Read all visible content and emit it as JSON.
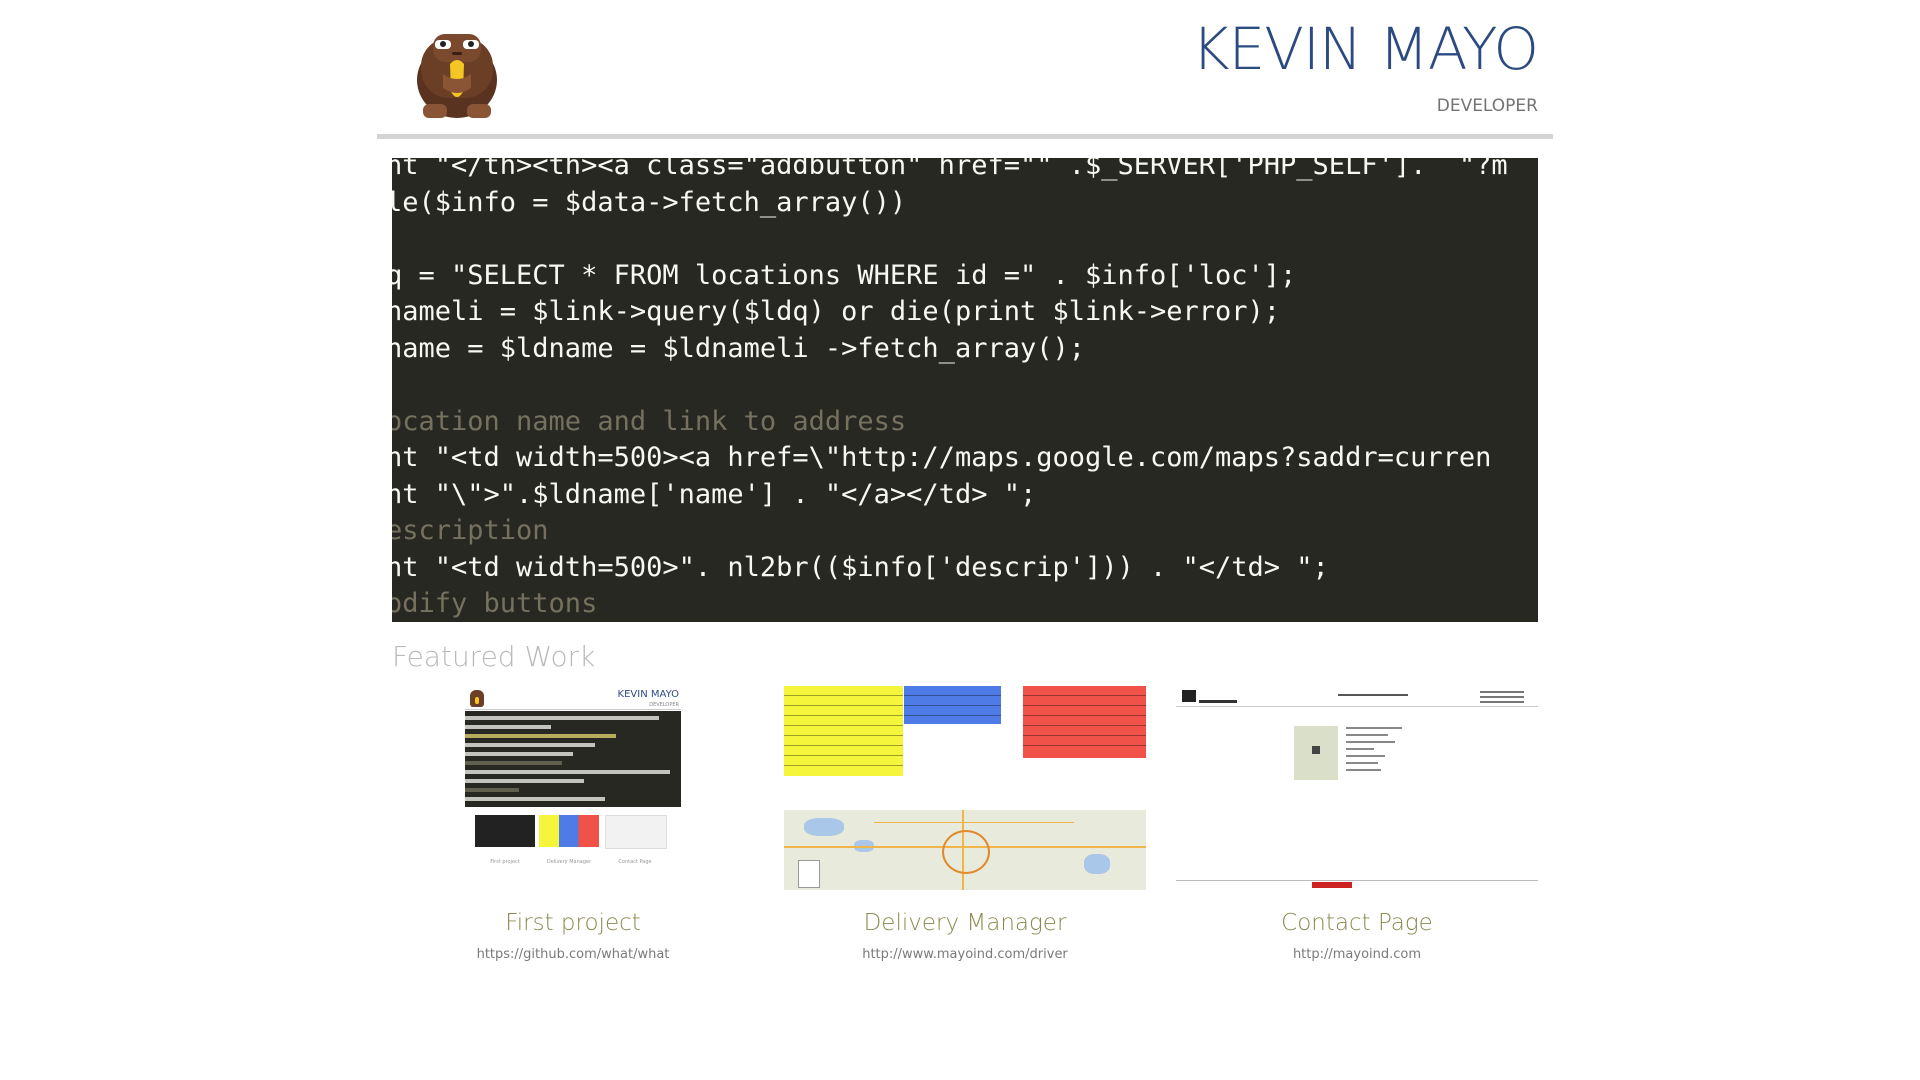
{
  "header": {
    "name": "KEVIN MAYO",
    "role": "DEVELOPER",
    "logo_icon": "gorilla-eating-banana-icon"
  },
  "hero": {
    "code_lines": [
      "nt \"</th><th><a class=\"addbutton\" href=\"\" .$_SERVER['PHP_SELF'].  \"?m",
      "le($info = $data->fetch_array())",
      "",
      "q = \"SELECT * FROM locations WHERE id =\" . $info['loc'];",
      "nameli = $link->query($ldq) or die(print $link->error);",
      "name = $ldname = $ldnameli ->fetch_array();",
      "",
      "ocation name and link to address",
      "nt \"<td width=500><a href=\\\"http://maps.google.com/maps?saddr=curren",
      "nt \"\\\">\".$ldname['name'] . \"</a></td> \";",
      "escription",
      "nt \"<td width=500>\". nl2br(($info['descrip'])) . \"</td> \";",
      "odify buttons"
    ]
  },
  "featured": {
    "title": "Featured Work",
    "cards": [
      {
        "title": "First project",
        "url": "https://github.com/what/what",
        "thumb_mini_name": "KEVIN MAYO",
        "thumb_mini_role": "DEVELOPER"
      },
      {
        "title": "Delivery Manager",
        "url": "http://www.mayoind.com/driver"
      },
      {
        "title": "Contact Page",
        "url": "http://mayoind.com"
      }
    ]
  },
  "colors": {
    "title_blue": "#2c4a82",
    "card_title_olive": "#8a8a4e",
    "code_bg": "#272822",
    "header_rule": "#d4d4d4"
  }
}
